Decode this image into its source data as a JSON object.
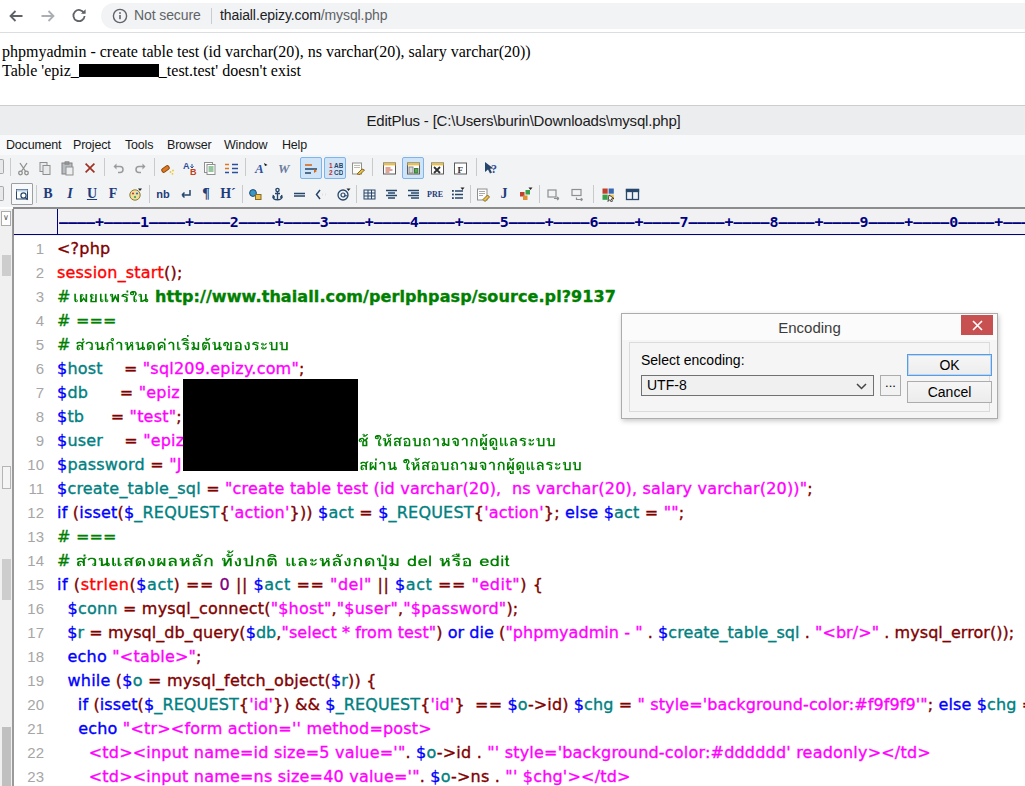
{
  "browser": {
    "security_text": "Not secure",
    "url_host": "thaiall.epizy.com",
    "url_path": "/mysql.php",
    "icons": [
      "back-icon",
      "forward-icon",
      "reload-icon",
      "info-icon"
    ]
  },
  "page": {
    "line1": "phpmyadmin - create table test (id varchar(20), ns varchar(20), salary varchar(20))",
    "line2_prefix": "Table 'epiz_",
    "line2_redacted": "[redacted]",
    "line2_suffix": "_test.test' doesn't exist"
  },
  "editplus": {
    "title": "EditPlus - [C:\\Users\\burin\\Downloads\\mysql.php]",
    "menu": [
      "Document",
      "Project",
      "Tools",
      "Browser",
      "Window",
      "Help"
    ],
    "toolbar_main": [
      "cut",
      "copy",
      "paste",
      "delete",
      "undo",
      "redo",
      "find",
      "replace",
      "copy-all",
      "indent",
      "font",
      "word-style",
      "word-wrap",
      "line-number",
      "preferences",
      "view-doc",
      "view-window",
      "view-tool",
      "view-func",
      "help"
    ],
    "toolbar_html": [
      "browser-preview",
      "bold",
      "italic",
      "underline",
      "font-tag",
      "color",
      "nbsp",
      "line-break",
      "paragraph",
      "heading",
      "image",
      "anchor",
      "horizontal-rule",
      "comment",
      "mailto",
      "table",
      "align-center",
      "align-right",
      "pre",
      "list",
      "script",
      "javascript",
      "applet",
      "span",
      "div",
      "window-color",
      "window-split"
    ],
    "ruler": "----+----1----+----2----+----3----+----4----+----5----+----6----+----7----+----8----+----9----+----0----+----"
  },
  "code": {
    "lines": [
      {
        "n": "1",
        "tokens": [
          [
            "op",
            "<?php"
          ]
        ]
      },
      {
        "n": "2",
        "tokens": [
          [
            "fn",
            "session_start"
          ],
          [
            "op",
            "();"
          ]
        ]
      },
      {
        "n": "3",
        "tokens": [
          [
            "cm",
            "# "
          ],
          [
            "svg",
            "thai3",
            "เผยแพร่ใน"
          ],
          [
            "cm url-wide",
            "http://www.thaiall.com/perlphpasp/source.pl?9137"
          ]
        ]
      },
      {
        "n": "4",
        "tokens": [
          [
            "cm",
            "# ==="
          ]
        ]
      },
      {
        "n": "5",
        "tokens": [
          [
            "cm",
            "# "
          ],
          [
            "svg",
            "thai5",
            "ส่วนกำหนดค่าเริ่มต้นของระบบ"
          ]
        ]
      },
      {
        "n": "6",
        "tokens": [
          [
            "dl",
            "$"
          ],
          [
            "vr",
            "host"
          ],
          [
            "pl",
            "    "
          ],
          [
            "op",
            "="
          ],
          [
            "pl",
            " "
          ],
          [
            "st",
            "\"sql209.epizy.com\""
          ],
          [
            "op",
            ";"
          ]
        ]
      },
      {
        "n": "7",
        "tokens": [
          [
            "dl",
            "$"
          ],
          [
            "vr",
            "db"
          ],
          [
            "pl",
            "      "
          ],
          [
            "op",
            "="
          ],
          [
            "pl",
            " "
          ],
          [
            "st",
            "\"epiz"
          ],
          [
            "redacted",
            ""
          ]
        ]
      },
      {
        "n": "8",
        "tokens": [
          [
            "dl",
            "$"
          ],
          [
            "vr",
            "tb"
          ],
          [
            "pl",
            "     "
          ],
          [
            "op",
            "="
          ],
          [
            "pl",
            " "
          ],
          [
            "st",
            "\"test\""
          ],
          [
            "op",
            ";"
          ]
        ]
      },
      {
        "n": "9",
        "tokens": [
          [
            "dl",
            "$"
          ],
          [
            "vr",
            "user"
          ],
          [
            "pl",
            "    "
          ],
          [
            "op",
            "="
          ],
          [
            "pl",
            " "
          ],
          [
            "st",
            "\"epiz"
          ],
          [
            "redacted",
            ""
          ],
          [
            "svg",
            "thai9",
            "ช้ ให้สอบถามจากผู้ดูแลระบบ"
          ]
        ]
      },
      {
        "n": "10",
        "tokens": [
          [
            "dl",
            "$"
          ],
          [
            "vr",
            "password"
          ],
          [
            "pl",
            " "
          ],
          [
            "op",
            "="
          ],
          [
            "pl",
            " "
          ],
          [
            "st",
            "\"J"
          ],
          [
            "redacted",
            ""
          ],
          [
            "svg",
            "thai10",
            "สผ่าน ให้สอบถามจากผู้ดูแลระบบ"
          ]
        ]
      },
      {
        "n": "11",
        "tokens": [
          [
            "dl",
            "$"
          ],
          [
            "vr",
            "create_table_sql"
          ],
          [
            "pl",
            " "
          ],
          [
            "op",
            "="
          ],
          [
            "pl",
            " "
          ],
          [
            "st",
            "\"create table test (id varchar(20),  ns varchar(20), salary varchar(20))\""
          ],
          [
            "op",
            ";"
          ]
        ]
      },
      {
        "n": "12",
        "tokens": [
          [
            "kw",
            "if"
          ],
          [
            "pl",
            " "
          ],
          [
            "op",
            "("
          ],
          [
            "kw",
            "isset"
          ],
          [
            "op",
            "("
          ],
          [
            "dl",
            "$"
          ],
          [
            "vr",
            "_REQUEST"
          ],
          [
            "op",
            "{"
          ],
          [
            "st",
            "'action'"
          ],
          [
            "op",
            "}))"
          ],
          [
            "pl",
            " "
          ],
          [
            "dl",
            "$"
          ],
          [
            "vr",
            "act"
          ],
          [
            "pl",
            " "
          ],
          [
            "op",
            "="
          ],
          [
            "pl",
            " "
          ],
          [
            "dl",
            "$"
          ],
          [
            "vr",
            "_REQUEST"
          ],
          [
            "op",
            "{"
          ],
          [
            "st",
            "'action'"
          ],
          [
            "op",
            "};"
          ],
          [
            "pl",
            " "
          ],
          [
            "kw",
            "else"
          ],
          [
            "pl",
            " "
          ],
          [
            "dl",
            "$"
          ],
          [
            "vr",
            "act"
          ],
          [
            "pl",
            " "
          ],
          [
            "op",
            "="
          ],
          [
            "pl",
            " "
          ],
          [
            "st",
            "\"\""
          ],
          [
            "op",
            ";"
          ]
        ]
      },
      {
        "n": "13",
        "tokens": [
          [
            "cm",
            "# ==="
          ]
        ]
      },
      {
        "n": "14",
        "tokens": [
          [
            "cm",
            "# "
          ],
          [
            "svg",
            "thai14",
            "ส่วนแสดงผลหลัก ทั้งปกติ และหลังกดปุ่ม del หรือ edit"
          ]
        ]
      },
      {
        "n": "15",
        "ls": "0.55px",
        "tokens": [
          [
            "kw",
            "if"
          ],
          [
            "pl",
            " "
          ],
          [
            "op",
            "("
          ],
          [
            "fn",
            "strlen"
          ],
          [
            "op",
            "("
          ],
          [
            "dl",
            "$"
          ],
          [
            "vr",
            "act"
          ],
          [
            "op",
            ")"
          ],
          [
            "pl",
            " "
          ],
          [
            "op",
            "=="
          ],
          [
            "pl",
            " "
          ],
          [
            "nu",
            "0"
          ],
          [
            "pl",
            " "
          ],
          [
            "op",
            "||"
          ],
          [
            "pl",
            " "
          ],
          [
            "dl",
            "$"
          ],
          [
            "vr",
            "act"
          ],
          [
            "pl",
            " "
          ],
          [
            "op",
            "=="
          ],
          [
            "pl",
            " "
          ],
          [
            "st",
            "\"del\""
          ],
          [
            "pl",
            " "
          ],
          [
            "op",
            "||"
          ],
          [
            "pl",
            " "
          ],
          [
            "dl",
            "$"
          ],
          [
            "vr",
            "act"
          ],
          [
            "pl",
            " "
          ],
          [
            "op",
            "=="
          ],
          [
            "pl",
            " "
          ],
          [
            "st",
            "\"edit\""
          ],
          [
            "op",
            ")"
          ],
          [
            "pl",
            " "
          ],
          [
            "op",
            "{"
          ]
        ]
      },
      {
        "n": "16",
        "tokens": [
          [
            "pl",
            "  "
          ],
          [
            "dl",
            "$"
          ],
          [
            "vr",
            "conn"
          ],
          [
            "pl",
            " "
          ],
          [
            "op",
            "="
          ],
          [
            "pl",
            " "
          ],
          [
            "op",
            "mysql_connect"
          ],
          [
            "op",
            "("
          ],
          [
            "st",
            "\"$host\""
          ],
          [
            "op",
            ","
          ],
          [
            "st",
            "\"$user\""
          ],
          [
            "op",
            ","
          ],
          [
            "st",
            "\"$password\""
          ],
          [
            "op",
            ");"
          ]
        ]
      },
      {
        "n": "17",
        "ls": "0.06px",
        "tokens": [
          [
            "pl",
            "  "
          ],
          [
            "dl",
            "$"
          ],
          [
            "vr",
            "r"
          ],
          [
            "pl",
            " "
          ],
          [
            "op",
            "="
          ],
          [
            "pl",
            " "
          ],
          [
            "op",
            "mysql_db_query"
          ],
          [
            "op",
            "("
          ],
          [
            "dl",
            "$"
          ],
          [
            "vr",
            "db"
          ],
          [
            "op",
            ","
          ],
          [
            "st",
            "\"select * from test\""
          ],
          [
            "op",
            ")"
          ],
          [
            "pl",
            " "
          ],
          [
            "kw",
            "or"
          ],
          [
            "pl",
            " "
          ],
          [
            "kw",
            "die"
          ],
          [
            "pl",
            " "
          ],
          [
            "op",
            "("
          ],
          [
            "st",
            "\"phpmyadmin - \""
          ],
          [
            "pl",
            " "
          ],
          [
            "op",
            "."
          ],
          [
            "pl",
            " "
          ],
          [
            "dl",
            "$"
          ],
          [
            "vr",
            "create_table_sql"
          ],
          [
            "pl",
            " "
          ],
          [
            "op",
            "."
          ],
          [
            "pl",
            " "
          ],
          [
            "st",
            "\"<br/>\""
          ],
          [
            "pl",
            " "
          ],
          [
            "op",
            "."
          ],
          [
            "pl",
            " "
          ],
          [
            "op",
            "mysql_error());"
          ]
        ]
      },
      {
        "n": "18",
        "tokens": [
          [
            "pl",
            "  "
          ],
          [
            "kw",
            "echo"
          ],
          [
            "pl",
            " "
          ],
          [
            "st",
            "\"<table>\""
          ],
          [
            "op",
            ";"
          ]
        ]
      },
      {
        "n": "19",
        "tokens": [
          [
            "pl",
            "  "
          ],
          [
            "kw",
            "while"
          ],
          [
            "pl",
            " "
          ],
          [
            "op",
            "("
          ],
          [
            "dl",
            "$"
          ],
          [
            "vr",
            "o"
          ],
          [
            "pl",
            " "
          ],
          [
            "op",
            "="
          ],
          [
            "pl",
            " "
          ],
          [
            "op",
            "mysql_fetch_object"
          ],
          [
            "op",
            "("
          ],
          [
            "dl",
            "$"
          ],
          [
            "vr",
            "r"
          ],
          [
            "op",
            "))"
          ],
          [
            "pl",
            " "
          ],
          [
            "op",
            "{"
          ]
        ]
      },
      {
        "n": "20",
        "ls": "0.12px",
        "tokens": [
          [
            "pl",
            "    "
          ],
          [
            "kw",
            "if"
          ],
          [
            "pl",
            " "
          ],
          [
            "op",
            "("
          ],
          [
            "kw",
            "isset"
          ],
          [
            "op",
            "("
          ],
          [
            "dl",
            "$"
          ],
          [
            "vr",
            "_REQUEST"
          ],
          [
            "op",
            "{"
          ],
          [
            "st",
            "'id'"
          ],
          [
            "op",
            "})"
          ],
          [
            "pl",
            " "
          ],
          [
            "op",
            "&&"
          ],
          [
            "pl",
            " "
          ],
          [
            "dl",
            "$"
          ],
          [
            "vr",
            "_REQUEST"
          ],
          [
            "op",
            "{"
          ],
          [
            "st",
            "'id'"
          ],
          [
            "op",
            "}"
          ],
          [
            "pl",
            "  "
          ],
          [
            "op",
            "=="
          ],
          [
            "pl",
            " "
          ],
          [
            "dl",
            "$"
          ],
          [
            "vr",
            "o"
          ],
          [
            "op",
            "->id)"
          ],
          [
            "pl",
            " "
          ],
          [
            "dl",
            "$"
          ],
          [
            "vr",
            "chg"
          ],
          [
            "pl",
            " "
          ],
          [
            "op",
            "="
          ],
          [
            "pl",
            " "
          ],
          [
            "st",
            "\" style='background-color:#f9f9f9'\""
          ],
          [
            "op",
            ";"
          ],
          [
            "pl",
            " "
          ],
          [
            "kw",
            "else"
          ],
          [
            "pl",
            " "
          ],
          [
            "dl",
            "$"
          ],
          [
            "vr",
            "chg"
          ],
          [
            "pl",
            " "
          ],
          [
            "op",
            "="
          ],
          [
            "pl",
            " "
          ],
          [
            "st",
            "\"\""
          ],
          [
            "op",
            ";"
          ]
        ]
      },
      {
        "n": "21",
        "tokens": [
          [
            "pl",
            "    "
          ],
          [
            "kw",
            "echo"
          ],
          [
            "pl",
            " "
          ],
          [
            "st",
            "\"<tr><form action='' method=post>"
          ]
        ]
      },
      {
        "n": "22",
        "tokens": [
          [
            "pl",
            "      "
          ],
          [
            "st",
            "<td><input name=id size=5 value='\""
          ],
          [
            "op",
            "."
          ],
          [
            "pl",
            " "
          ],
          [
            "dl",
            "$"
          ],
          [
            "vr",
            "o"
          ],
          [
            "op",
            "->id"
          ],
          [
            "pl",
            " "
          ],
          [
            "op",
            "."
          ],
          [
            "pl",
            " "
          ],
          [
            "st",
            "\"' style='background-color:#dddddd' readonly></td>"
          ]
        ]
      },
      {
        "n": "23",
        "tokens": [
          [
            "pl",
            "      "
          ],
          [
            "st",
            "<td><input name=ns size=40 value='\""
          ],
          [
            "op",
            "."
          ],
          [
            "pl",
            " "
          ],
          [
            "dl",
            "$"
          ],
          [
            "vr",
            "o"
          ],
          [
            "op",
            "->ns"
          ],
          [
            "pl",
            " "
          ],
          [
            "op",
            "."
          ],
          [
            "pl",
            " "
          ],
          [
            "st",
            "\"' $chg'></td>"
          ]
        ]
      }
    ]
  },
  "colors": {
    "keyword": "#0000FF",
    "string": "#FF00FF",
    "comment": "#008000",
    "variable": "#008080",
    "function": "#FF0000",
    "operator": "#800000",
    "number": "#800080",
    "ruler": "#000080",
    "close_button": "#C75050",
    "address_bar": "#F1F3F4"
  },
  "dialog": {
    "title": "Encoding",
    "close_label": "x",
    "label": "Select encoding:",
    "combo_value": "UTF-8",
    "more_label": "...",
    "ok_label": "OK",
    "cancel_label": "Cancel"
  }
}
